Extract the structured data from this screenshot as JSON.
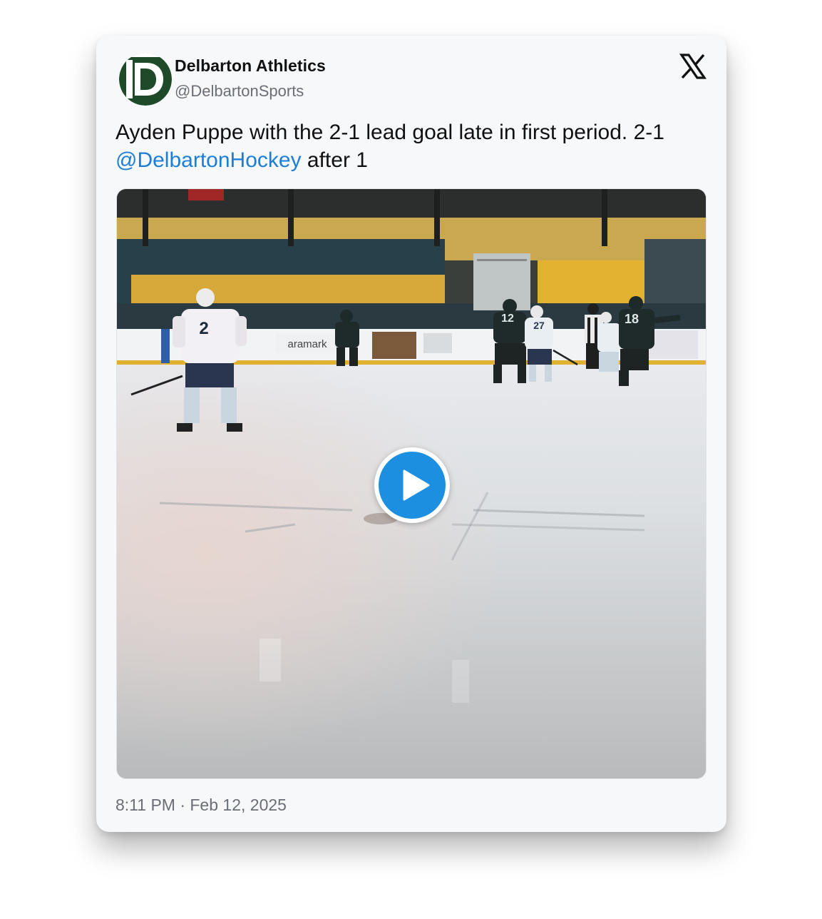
{
  "author": {
    "name": "Delbarton Athletics",
    "handle": "@DelbartonSports",
    "avatar_icon": "delbarton-d-logo-icon",
    "brand_color": "#1e4a2a"
  },
  "platform_icon": "x-logo-icon",
  "tweet": {
    "text_before": "Ayden Puppe with the 2-1 lead goal late in first period. 2-1 ",
    "mention": "@DelbartonHockey",
    "text_after": " after 1",
    "mention_color": "#1d7ed6"
  },
  "media": {
    "type": "video",
    "play_icon": "play-icon",
    "play_color": "#1d8fe0",
    "board_text": "aramark",
    "jersey_numbers": [
      "2",
      "12",
      "27",
      "18"
    ]
  },
  "timestamp": "8:11 PM · Feb 12, 2025"
}
